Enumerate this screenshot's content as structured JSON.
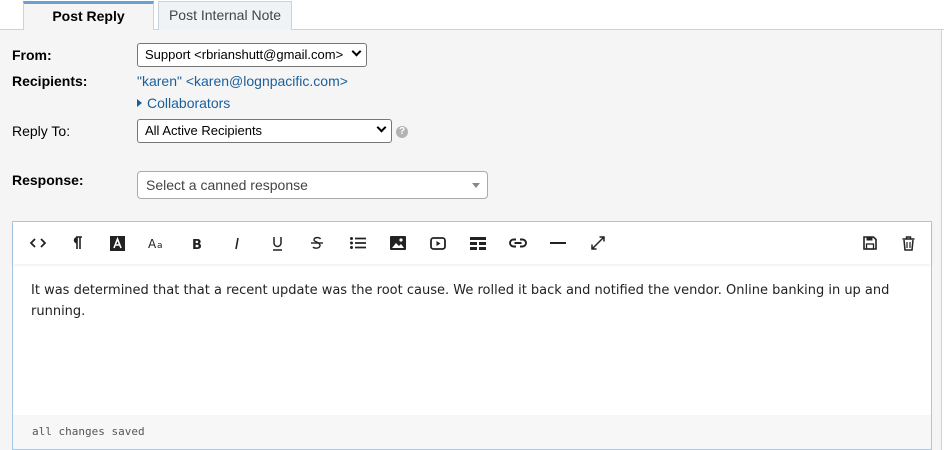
{
  "tabs": [
    {
      "label": "Post Reply",
      "active": true
    },
    {
      "label": "Post Internal Note",
      "active": false
    }
  ],
  "form": {
    "from_label": "From:",
    "from_value": "Support <rbrianshutt@gmail.com>",
    "recipients_label": "Recipients:",
    "recipient": "\"karen\" <karen@lognpacific.com>",
    "collaborators_label": "Collaborators",
    "reply_to_label": "Reply To:",
    "reply_to_value": "All Active Recipients",
    "help_icon": "?",
    "response_label": "Response:",
    "response_placeholder": "Select a canned response"
  },
  "editor": {
    "toolbar": [
      "code-view",
      "paragraph",
      "text-color",
      "font-size",
      "bold",
      "italic",
      "underline",
      "strikethrough",
      "bulleted-list",
      "insert-image",
      "insert-video",
      "insert-table",
      "insert-link",
      "horizontal-rule",
      "fullscreen",
      "save-draft",
      "delete-draft"
    ],
    "body": "It was determined that that a recent update was the root cause.  We rolled it back and notified the vendor.  Online banking in up and running.",
    "status": "all changes saved"
  },
  "colors": {
    "tab_accent": "#6aa0d2",
    "link": "#1b5f9a",
    "editor_border": "#a9c8e3",
    "panel_bg": "#f5f5f5"
  }
}
